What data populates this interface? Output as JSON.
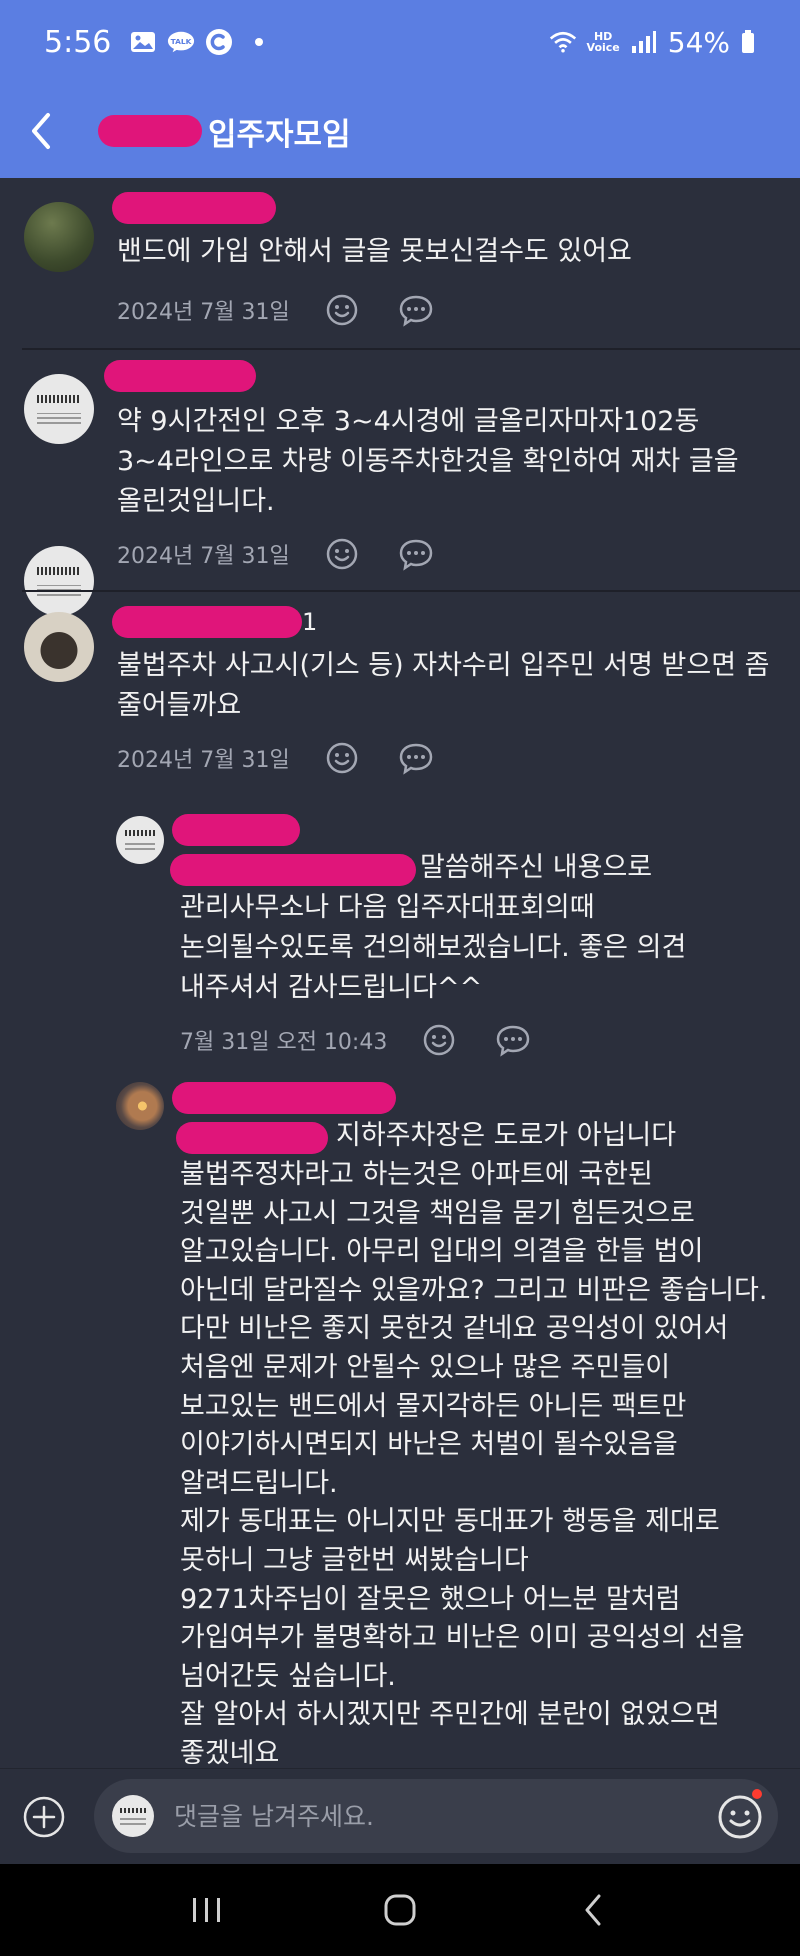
{
  "status_bar": {
    "time": "5:56",
    "battery": "54%",
    "icons": [
      "gallery-icon",
      "talk-icon",
      "c-app-icon",
      "wifi-icon",
      "hd-voice-icon",
      "signal-icon",
      "battery-icon"
    ],
    "hd_top": "HD",
    "hd_bottom": "Voice"
  },
  "app_bar": {
    "title": "입주자모임",
    "background": "#5b7ee2"
  },
  "comments": [
    {
      "date": "2024년 7월 31일",
      "text": "밴드에 가입 안해서 글을 못보신걸수도 있어요"
    },
    {
      "date": "2024년 7월 31일",
      "text": "약 9시간전인 오후 3~4시경에 글올리자마자102동\n3~4라인으로 차량 이동주차한것을 확인하여 재차 글을\n올린것입니다."
    },
    {
      "name_suffix": "1",
      "date": "2024년 7월 31일",
      "text": "불법주차 사고시(기스 등) 자차수리 입주민 서명 받으면 좀\n줄어들까요"
    },
    {
      "date": "7월 31일 오전 10:43",
      "text_first": "말씀해주신 내용으로",
      "text_rest": "관리사무소나 다음 입주자대표회의때\n논의될수있도록 건의해보겠습니다. 좋은 의견\n내주셔서 감사드립니다^^"
    },
    {
      "text_first": "지하주차장은 도로가 아닙니다",
      "text_rest": "불법주정차라고 하는것은 아파트에 국한된\n것일뿐 사고시 그것을 책임을 묻기 힘든것으로\n알고있습니다. 아무리 입대의 의결을 한들 법이\n아닌데 달라질수 있을까요? 그리고 비판은 좋습니다.\n다만 비난은 좋지 못한것 같네요 공익성이 있어서\n처음엔 문제가 안될수 있으나 많은 주민들이\n보고있는 밴드에서 몰지각하든 아니든 팩트만\n이야기하시면되지 바난은 처벌이 될수있음을\n알려드립니다.\n제가 동대표는 아니지만 동대표가 행동을 제대로\n못하니 그냥 글한번 써봤습니다\n9271차주님이 잘못은 했으나 어느분 말처럼\n가입여부가 불명확하고 비난은 이미 공익성의 선을\n넘어간듯 싶습니다.\n잘 알아서 하시겠지만 주민간에 분란이 없었으면\n좋겠네요"
    }
  ],
  "comment_input": {
    "placeholder": "댓글을 남겨주세요."
  },
  "nav": [
    "recents-icon",
    "home-icon",
    "back-icon"
  ]
}
